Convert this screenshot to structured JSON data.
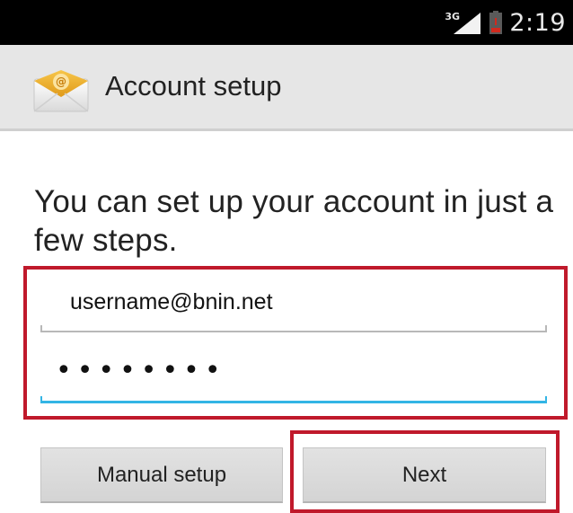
{
  "status_bar": {
    "network_type": "3G",
    "time": "2:19"
  },
  "action_bar": {
    "app_icon": "email-envelope-icon",
    "title": "Account setup"
  },
  "prompt": "You can set up your account in just a few steps.",
  "form": {
    "email_value": "username@bnin.net",
    "password_value": "••••••••"
  },
  "buttons": {
    "manual_label": "Manual setup",
    "next_label": "Next"
  },
  "colors": {
    "highlight": "#c0192b",
    "focus_underline": "#33b5e5"
  }
}
